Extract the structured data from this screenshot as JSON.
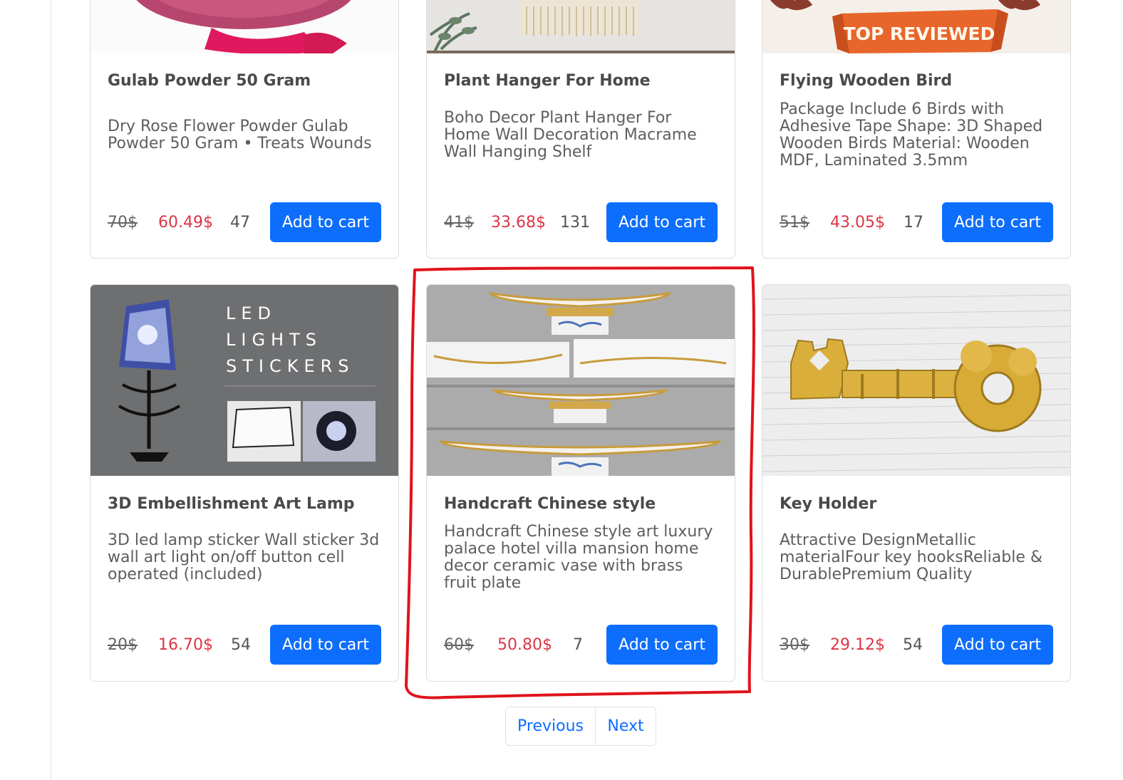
{
  "products": [
    {
      "title": "Gulab Powder 50 Gram",
      "description": "Dry Rose Flower Powder Gulab Powder 50 Gram • Treats Wounds",
      "old_price": "70$",
      "new_price": "60.49$",
      "quantity": "47",
      "button_label": "Add to cart"
    },
    {
      "title": "Plant Hanger For Home",
      "description": "Boho Decor Plant Hanger For Home Wall Decoration Macrame Wall Hanging Shelf",
      "old_price": "41$",
      "new_price": "33.68$",
      "quantity": "131",
      "button_label": "Add to cart"
    },
    {
      "title": "Flying Wooden Bird",
      "description": "Package Include 6 Birds with Adhesive Tape Shape: 3D Shaped Wooden Birds Material: Wooden MDF, Laminated 3.5mm",
      "image_text": "TOP REVIEWED",
      "old_price": "51$",
      "new_price": "43.05$",
      "quantity": "17",
      "button_label": "Add to cart"
    },
    {
      "title": "3D Embellishment Art Lamp",
      "description": "3D led lamp sticker Wall sticker 3d wall art light on/off button cell operated (included)",
      "image_text": [
        "LED",
        "LIGHTS",
        "STICKERS"
      ],
      "old_price": "20$",
      "new_price": "16.70$",
      "quantity": "54",
      "button_label": "Add to cart"
    },
    {
      "title": "Handcraft Chinese style",
      "description": "Handcraft Chinese style art luxury palace hotel villa mansion home decor ceramic vase with brass fruit plate",
      "old_price": "60$",
      "new_price": "50.80$",
      "quantity": "7",
      "button_label": "Add to cart"
    },
    {
      "title": "Key Holder",
      "description": "Attractive DesignMetallic materialFour key hooksReliable & DurablePremium Quality",
      "old_price": "30$",
      "new_price": "29.12$",
      "quantity": "54",
      "button_label": "Add to cart"
    }
  ],
  "pagination": {
    "previous_label": "Previous",
    "next_label": "Next"
  },
  "colors": {
    "button": "#0d6efd",
    "sale_price": "#dc3545",
    "highlight": "#e0131b"
  }
}
